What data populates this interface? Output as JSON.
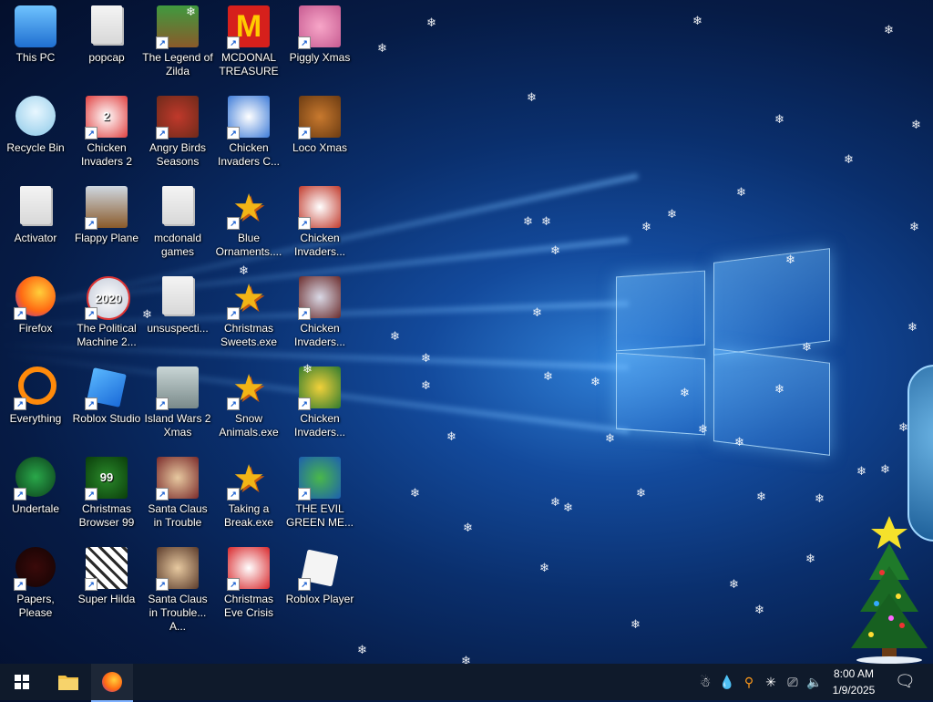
{
  "desktop": {
    "icons": [
      {
        "label": "This PC"
      },
      {
        "label": "popcap"
      },
      {
        "label": "The Legend of Zilda"
      },
      {
        "label": "MCDONAL TREASURE"
      },
      {
        "label": "Piggly Xmas"
      },
      {
        "label": "Recycle Bin"
      },
      {
        "label": "Chicken Invaders 2"
      },
      {
        "label": "Angry Birds Seasons"
      },
      {
        "label": "Chicken Invaders C..."
      },
      {
        "label": "Loco Xmas"
      },
      {
        "label": "Activator"
      },
      {
        "label": "Flappy Plane"
      },
      {
        "label": "mcdonald games"
      },
      {
        "label": "Blue Ornaments...."
      },
      {
        "label": "Chicken Invaders..."
      },
      {
        "label": "Firefox"
      },
      {
        "label": "The Political Machine 2..."
      },
      {
        "label": "unsuspecti..."
      },
      {
        "label": "Christmas Sweets.exe"
      },
      {
        "label": "Chicken Invaders..."
      },
      {
        "label": "Everything"
      },
      {
        "label": "Roblox Studio"
      },
      {
        "label": "Island Wars 2 Xmas"
      },
      {
        "label": "Snow Animals.exe"
      },
      {
        "label": "Chicken Invaders..."
      },
      {
        "label": "Undertale"
      },
      {
        "label": "Christmas Browser 99"
      },
      {
        "label": "Santa Claus in Trouble"
      },
      {
        "label": "Taking a Break.exe"
      },
      {
        "label": "THE EVIL GREEN ME..."
      },
      {
        "label": "Papers, Please"
      },
      {
        "label": "Super Hilda"
      },
      {
        "label": "Santa Claus in Trouble... A..."
      },
      {
        "label": "Christmas Eve Crisis"
      },
      {
        "label": "Roblox Player"
      }
    ],
    "badges": {
      "mcdonalds": "M",
      "ci2": "2",
      "political": "2020",
      "browser99": "99"
    }
  },
  "taskbar": {
    "time": "8:00 AM",
    "date": "1/9/2025"
  },
  "colors": {
    "taskbar": "#0f1a2b",
    "accent": "#1a73e8"
  }
}
